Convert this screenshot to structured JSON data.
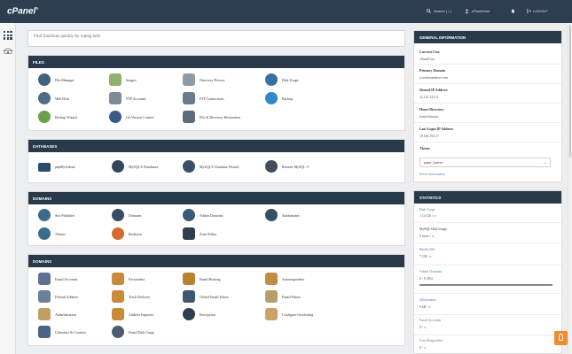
{
  "header": {
    "logo": "cPanel",
    "logo_mark": "®",
    "search_label": "Search ( / )",
    "user": "cPanelUser",
    "logout": "LOGOUT"
  },
  "search": {
    "placeholder": "Find functions quickly by typing here"
  },
  "panels": {
    "files": {
      "title": "FILES",
      "items": [
        "File Manager",
        "Images",
        "Directory Privacy",
        "Disk Usage",
        "Web Disk",
        "FTP Accounts",
        "FTP Connections",
        "Backup",
        "Backup Wizard",
        "Git Version Control",
        "File & Directory Restoration"
      ]
    },
    "databases": {
      "title": "DATABASES",
      "items": [
        "phpMyAdmin",
        "MySQL® Databases",
        "MySQL® Database Wizard",
        "Remote MySQL ®"
      ]
    },
    "domains": {
      "title": "DOMAINS",
      "items": [
        "Site Publisher",
        "Domains",
        "Addon Domains",
        "Subdomains",
        "Aliases",
        "Redirects",
        "Zone Editor"
      ]
    },
    "email": {
      "title": "DOMAINS",
      "items": [
        "Email Accounts",
        "Forwarders",
        "Email Routing",
        "Autoresponders",
        "Default Address",
        "Track Delivery",
        "Global Email Filters",
        "Email Filters",
        "Authentication",
        "Address Importer",
        "Encryption",
        "Configure Greylisting",
        "Calendars & Contacts",
        "Email Disk Usage"
      ]
    }
  },
  "general": {
    "title": "GENERAL INFORMATION",
    "current_user_label": "Current User",
    "current_user": "cPanelUser",
    "primary_domain_label": "Primary Domain",
    "primary_domain": "yourdomainhere.com",
    "shared_ip_label": "Shared IP Address",
    "shared_ip": "12.123.123.11",
    "home_dir_label": "Home Directory",
    "home_dir": "home/domain",
    "last_login_label": "Last Login IP Address",
    "last_login": "10.168.192.17",
    "theme_label": "Theme",
    "theme_value": "paper_lantern",
    "server_info": "Server Information"
  },
  "statistics": {
    "title": "STATISTICS",
    "rows": [
      {
        "label": "Disk Usage",
        "value": "1.14 GB / ∞",
        "percent": 0
      },
      {
        "label": "MySQL Disk Usage",
        "value": "0 bytes / ∞",
        "percent": 0
      },
      {
        "label": "Bandwidth",
        "value": "7 GB / ∞",
        "percent": 0
      },
      {
        "label": "Addon Domains",
        "value": "0 / 0 (0%)",
        "percent": 100
      },
      {
        "label": "Subdomains",
        "value": "0 kB / ∞",
        "percent": 0
      },
      {
        "label": "Email Accounts",
        "value": "0 / ∞",
        "percent": 0
      },
      {
        "label": "Auto Responders",
        "value": "0 / ∞",
        "percent": 0
      }
    ]
  },
  "colors": {
    "header": "#2c3e50",
    "panel_header": "#293a4a",
    "accent": "#f08a2c",
    "link": "#5a80b0"
  }
}
